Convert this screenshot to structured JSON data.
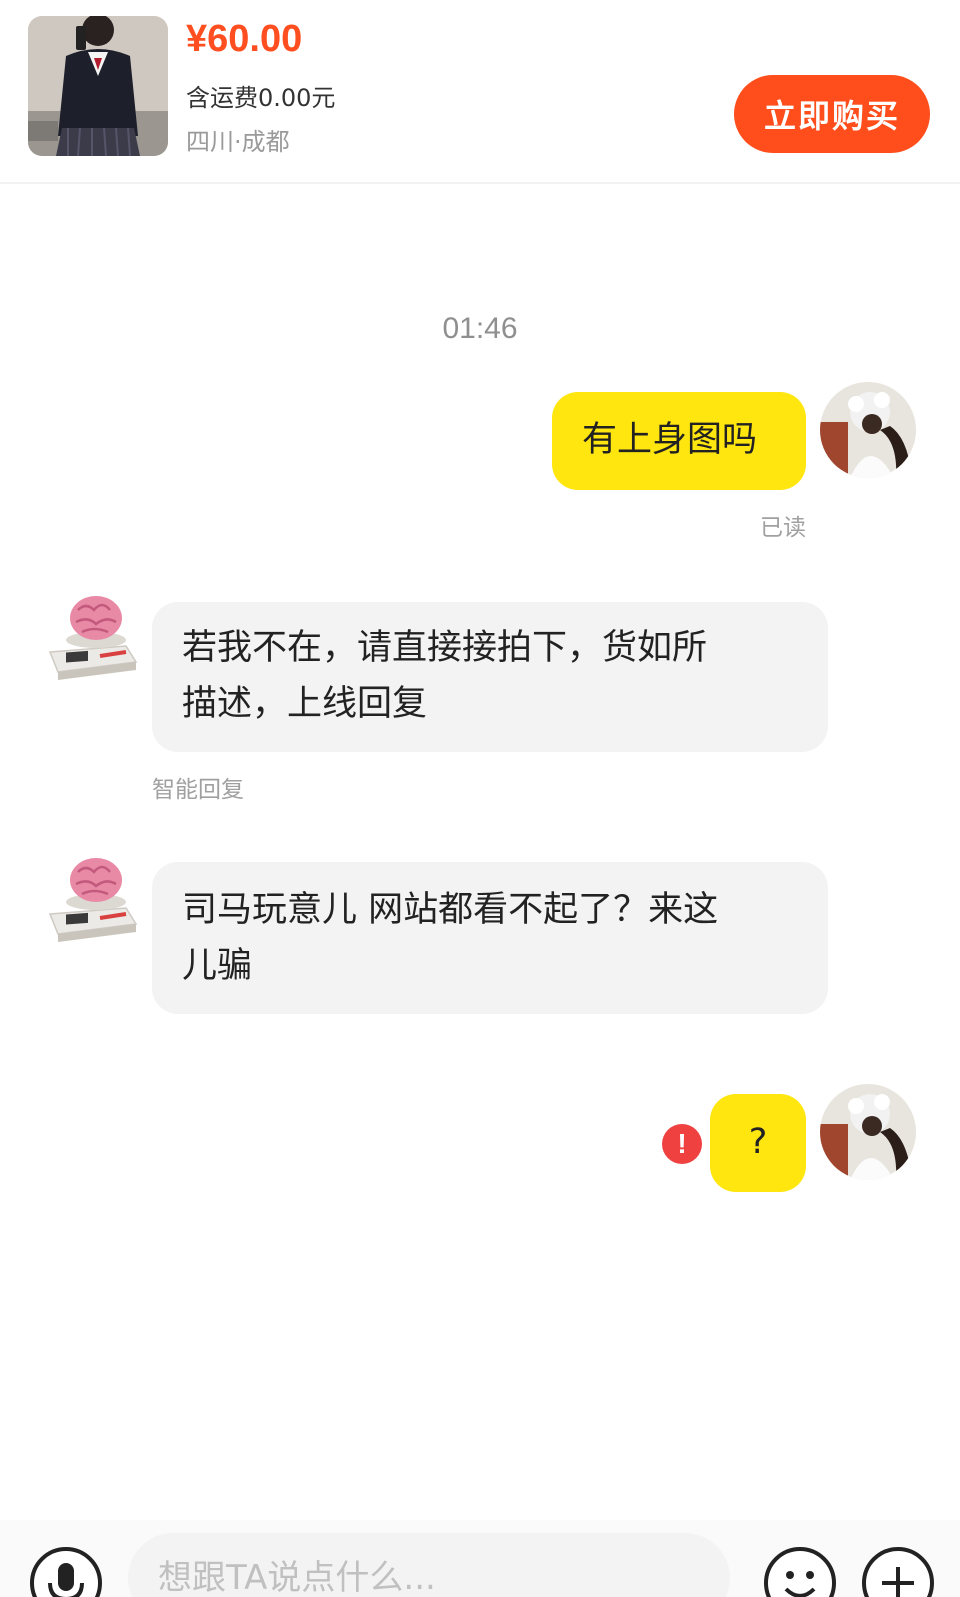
{
  "product": {
    "price": "¥60.00",
    "shipping": "含运费0.00元",
    "location": "四川·成都",
    "buy_label": "立即购买"
  },
  "chat": {
    "timestamp": "01:46",
    "messages": [
      {
        "sender": "me",
        "text": "有上身图吗",
        "status": "已读"
      },
      {
        "sender": "seller",
        "text_line1": "若我不在，请直接接拍下，货如所",
        "text_line2": "描述，上线回复",
        "tag": "智能回复"
      },
      {
        "sender": "seller",
        "text_line1": "司马玩意儿 网站都看不起了？来这",
        "text_line2": "儿骗"
      },
      {
        "sender": "me",
        "text": "?",
        "status": "send-failed"
      }
    ]
  },
  "input": {
    "placeholder": "想跟TA说点什么..."
  },
  "colors": {
    "accent": "#ff4d1c",
    "my_bubble": "#ffe60f",
    "their_bubble": "#f3f3f3",
    "error": "#f04141"
  },
  "icons": [
    "microphone-icon",
    "emoji-icon",
    "plus-icon",
    "error-icon"
  ]
}
